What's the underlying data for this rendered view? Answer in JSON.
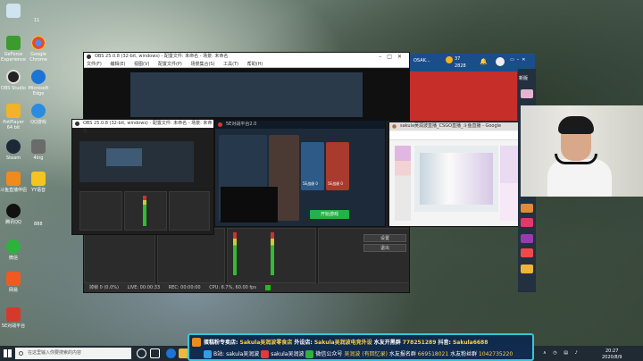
{
  "desktop": {
    "icons": [
      {
        "label": "",
        "color": "#cfe3f0"
      },
      {
        "label": "GeForce Experience",
        "color": "#3c9a2e"
      },
      {
        "label": "Google Chrome",
        "color": "#e24a3b"
      },
      {
        "label": "OBS Studio",
        "color": "#222222"
      },
      {
        "label": "Microsoft Edge",
        "color": "#1b74d6"
      },
      {
        "label": "PotPlayer 64 bit",
        "color": "#f0b32a"
      },
      {
        "label": "QQ游戏",
        "color": "#2a8be0"
      },
      {
        "label": "Steam",
        "color": "#1b2838"
      },
      {
        "label": "4ing",
        "color": "#6b6b6b"
      },
      {
        "label": "斗鱼直播伴侣",
        "color": "#f08a1c"
      },
      {
        "label": "YY语音",
        "color": "#f5c51e"
      },
      {
        "label": "腾讯QQ",
        "color": "#111111"
      },
      {
        "label": "微信",
        "color": "#2db33b"
      },
      {
        "label": "网易",
        "color": "#f05a22"
      },
      {
        "label": "5E对战平台",
        "color": "#d33a2c"
      }
    ],
    "top_label": "11",
    "qq_label": "888"
  },
  "obs_back": {
    "title": "OBS 25.0.8 (32-bit, windows) - 配置文件: 未命名 - 场景: 未命名",
    "menu": [
      "文件(F)",
      "编辑(E)",
      "视图(V)",
      "配置文件(P)",
      "场景集合(S)",
      "工具(T)",
      "帮助(H)"
    ],
    "status": [
      "掉帧 0 (0.0%)",
      "LIVE: 00:00:33",
      "REC: 00:00:00",
      "CPU: 6.7%, 60.00 fps"
    ],
    "buttons": [
      "设置",
      "退出"
    ]
  },
  "obs_front": {
    "title": "OBS 25.0.8 (32-bit, windows) - 配置文件: 未命名 - 场景: 未命名"
  },
  "game": {
    "title": "5E对战平台2.0",
    "start_label": "开始游戏",
    "stats": [
      "5E战绩 0",
      "5E战绩 0"
    ]
  },
  "chrome": {
    "title": "sakula吴润波直播_CSGO直播_斗鱼直播 - Google Chrome"
  },
  "douyu_header": {
    "tab": "OSAK...",
    "coins": "37",
    "fish": "2828",
    "badge": "新版"
  },
  "taskbar": {
    "search_placeholder": "在这里输入你要搜索的内容",
    "time": "20:27",
    "date": "2020/8/9"
  },
  "banner": {
    "line1_a": "蛋糕粉专卖店:",
    "line1_b": "Sakula吴润波零食店",
    "line1_c": "外设店:",
    "line1_d": "Sakula吴润波电竞外设",
    "line1_e": "水友开黑群",
    "line1_f": "778251289",
    "line1_g": "抖音:",
    "line1_h": "Sakula6688",
    "line2_a": "B站:",
    "line2_b": "sakula吴润波",
    "line2_c": "sakula吴润波",
    "line2_d": "微信公众号",
    "line2_e": "吴润波 (有回忆录)",
    "line2_f": "水友报名群",
    "line2_g": "669518021",
    "line2_h": "水友粉丝群",
    "line2_i": "1042735220"
  }
}
